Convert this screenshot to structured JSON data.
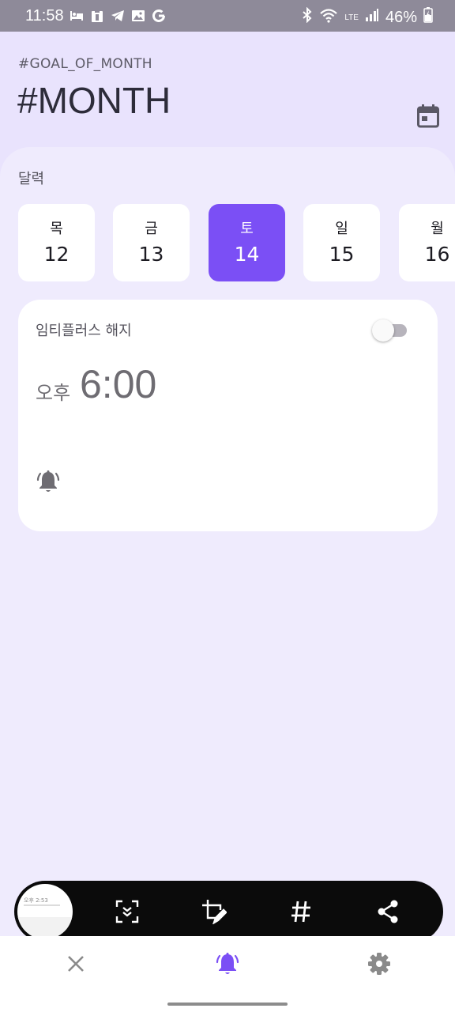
{
  "status_bar": {
    "time": "11:58",
    "battery": "46%",
    "network": "LTE",
    "icons": [
      "sleep-icon",
      "clipboard-icon",
      "telegram-icon",
      "gallery-icon",
      "google-icon",
      "bluetooth-icon",
      "wifi-icon",
      "signal-icon",
      "battery-icon"
    ]
  },
  "header": {
    "goal_label": "#GOAL_OF_MONTH",
    "title": "#MONTH",
    "calendar_icon": "calendar-icon"
  },
  "calendar": {
    "section_label": "달력",
    "days": [
      {
        "dow": "목",
        "num": "12",
        "selected": false
      },
      {
        "dow": "금",
        "num": "13",
        "selected": false
      },
      {
        "dow": "토",
        "num": "14",
        "selected": true
      },
      {
        "dow": "일",
        "num": "15",
        "selected": false
      },
      {
        "dow": "월",
        "num": "16",
        "selected": false
      }
    ]
  },
  "alarm": {
    "name": "임티플러스 해지",
    "ampm": "오후",
    "time": "6:00",
    "enabled": false,
    "bell_icon": "alarm-bell-icon"
  },
  "screenshot_toolbar": {
    "thumbnail_text": "오후 2:53",
    "buttons": [
      "scroll-capture-icon",
      "crop-edit-icon",
      "hashtag-icon",
      "share-icon"
    ]
  },
  "bottom_nav": {
    "items": [
      "close-icon",
      "alarm-icon",
      "settings-icon"
    ],
    "active": "alarm-icon"
  },
  "colors": {
    "accent": "#7b4ff5",
    "background": "#e9e3fd",
    "card": "#ffffff",
    "status_bar": "#8e8a99"
  }
}
